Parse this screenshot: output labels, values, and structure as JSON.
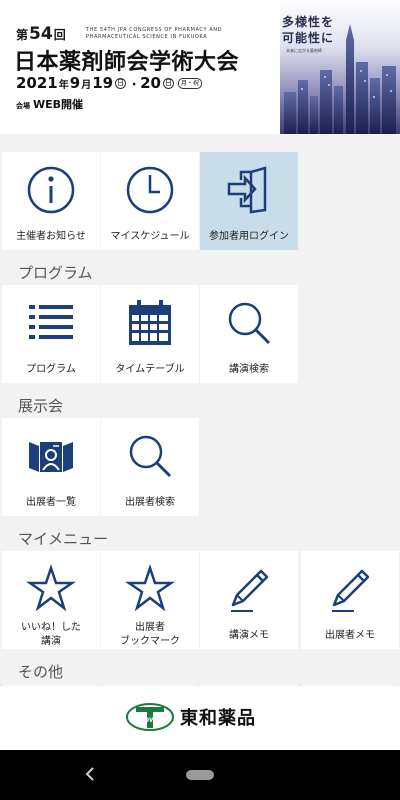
{
  "banner": {
    "dai": "第",
    "number": "54",
    "kai": "回",
    "english": "The 54th JPA Congress of Pharmacy and Pharmaceutical Science in FUKUOKA",
    "title": "日本薬剤師会学術大会",
    "date": {
      "year": "2021",
      "nen": "年",
      "month": "9",
      "tsuki": "月",
      "day1": "19",
      "weekday1": "日",
      "separator": "・",
      "day2": "20",
      "weekday2": "日",
      "holiday": "月・祝"
    },
    "venue_label": "会場",
    "venue": "WEB開催",
    "slogan_line1": "多様性を",
    "slogan_line2": "可能性に",
    "slogan_sub": "未来に広がる薬剤師"
  },
  "menu": {
    "top": [
      {
        "label": "主催者お知らせ",
        "icon": "info-icon"
      },
      {
        "label": "マイスケジュール",
        "icon": "clock-icon"
      },
      {
        "label": "参加者用ログイン",
        "icon": "login-icon"
      }
    ],
    "program": {
      "header": "プログラム",
      "items": [
        {
          "label": "プログラム",
          "icon": "list-icon"
        },
        {
          "label": "タイムテーブル",
          "icon": "calendar-icon"
        },
        {
          "label": "講演検索",
          "icon": "search-icon"
        }
      ]
    },
    "exhibition": {
      "header": "展示会",
      "items": [
        {
          "label": "出展者一覧",
          "icon": "exhibitor-icon"
        },
        {
          "label": "出展者検索",
          "icon": "search-icon"
        }
      ]
    },
    "mymenu": {
      "header": "マイメニュー",
      "items": [
        {
          "label_line1": "いいね！した",
          "label_line2": "講演",
          "icon": "star-icon"
        },
        {
          "label_line1": "出展者",
          "label_line2": "ブックマーク",
          "icon": "star-icon"
        },
        {
          "label": "講演メモ",
          "icon": "pencil-icon"
        },
        {
          "label": "出展者メモ",
          "icon": "pencil-icon"
        }
      ]
    },
    "other": {
      "header": "その他"
    }
  },
  "sponsor": {
    "logo_text": "TOWA",
    "name": "東和薬品"
  },
  "colors": {
    "icon": "#1c3e7a",
    "active_tile": "#c9dcea",
    "background": "#f2f2f2"
  }
}
